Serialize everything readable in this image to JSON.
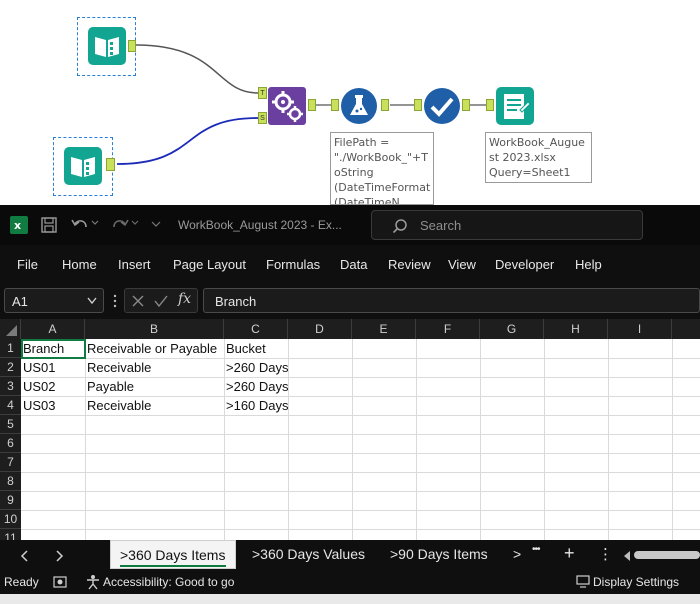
{
  "canvas": {
    "formula_annotation": "FilePath =\n\"./WorkBook_\"+T\noString\n(DateTimeFormat\n(DateTimeN",
    "output_annotation": "WorkBook_Augue\nst 2023.xlsx\nQuery=Sheet1",
    "anchor_t": "T",
    "anchor_s": "S"
  },
  "window": {
    "title": "WorkBook_August 2023  -  Ex...",
    "search_placeholder": "Search"
  },
  "ribbon": {
    "tabs": [
      "File",
      "Home",
      "Insert",
      "Page Layout",
      "Formulas",
      "Data",
      "Review",
      "View",
      "Developer",
      "Help"
    ]
  },
  "formula_bar": {
    "name_box": "A1",
    "formula": "Branch"
  },
  "grid": {
    "columns": [
      "A",
      "B",
      "C",
      "D",
      "E",
      "F",
      "G",
      "H",
      "I"
    ],
    "rows": [
      "1",
      "2",
      "3",
      "4",
      "5",
      "6",
      "7",
      "8",
      "9",
      "10",
      "11"
    ],
    "cells": [
      [
        "Branch",
        "Receivable or Payable",
        "Bucket"
      ],
      [
        "US01",
        "Receivable",
        ">260 Days"
      ],
      [
        "US02",
        "Payable",
        ">260 Days"
      ],
      [
        "US03",
        "Receivable",
        ">160 Days"
      ]
    ]
  },
  "sheets": {
    "tabs": [
      ">360 Days Items",
      ">360 Days Values",
      ">90 Days Items"
    ],
    "more": ">",
    "ellipsis": "•••",
    "add": "+",
    "kebab": "⋮"
  },
  "status": {
    "ready": "Ready",
    "accessibility": "Accessibility: Good to go",
    "display_settings": "Display Settings"
  },
  "colors": {
    "excel_green": "#107c41",
    "alteryx_teal": "#11a592",
    "alteryx_purple": "#6b3fa0",
    "alteryx_blue": "#1f5fa8"
  }
}
